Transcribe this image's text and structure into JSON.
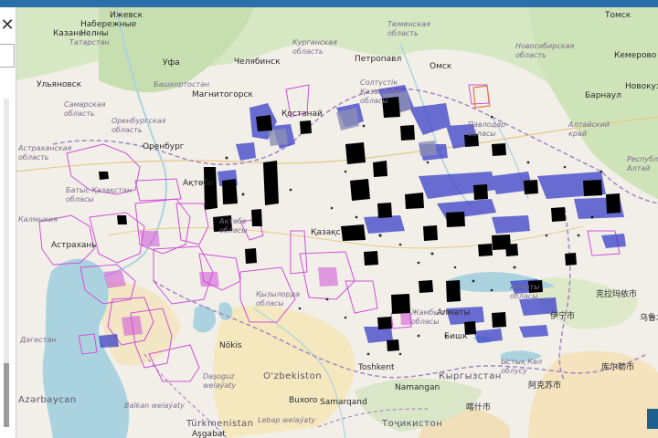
{
  "ui": {
    "close_icon": "✕",
    "accent_color": "#2a6fa8",
    "licence_outline": "#d050d8",
    "licence_fill": "#3a3fc8",
    "exploitation_fill": "#000000"
  },
  "labels": {
    "cities": [
      {
        "id": "izhevsk",
        "text": "Ижевск"
      },
      {
        "id": "chelny",
        "text": "Набережные\nЧелны"
      },
      {
        "id": "kazan",
        "text": "Казань"
      },
      {
        "id": "ufa",
        "text": "Уфа"
      },
      {
        "id": "chelyabinsk",
        "text": "Челябинск"
      },
      {
        "id": "magnitogorsk",
        "text": "Магнитогорск"
      },
      {
        "id": "ulyanovsk",
        "text": "Ульяновск"
      },
      {
        "id": "orenburg",
        "text": "Оренбург"
      },
      {
        "id": "petropavl",
        "text": "Петропавл"
      },
      {
        "id": "omsk",
        "text": "Омск"
      },
      {
        "id": "tomsk",
        "text": "Томск"
      },
      {
        "id": "kemerovo",
        "text": "Кемерово"
      },
      {
        "id": "novokuz",
        "text": "Новокуз"
      },
      {
        "id": "barnaul",
        "text": "Барнаул"
      },
      {
        "id": "kostanay",
        "text": "Қостанай"
      },
      {
        "id": "aktobe",
        "text": "Ақтөбе"
      },
      {
        "id": "astrakhan",
        "text": "Астрахань"
      },
      {
        "id": "kazakhstan",
        "text": "Қазақс"
      },
      {
        "id": "nukus",
        "text": "Nökis"
      },
      {
        "id": "bukhara",
        "text": "Buxoro"
      },
      {
        "id": "samarkand",
        "text": "Samarqand"
      },
      {
        "id": "tashkent",
        "text": "Toshkent"
      },
      {
        "id": "namangan",
        "text": "Namangan"
      },
      {
        "id": "almaty",
        "text": "Алматы"
      },
      {
        "id": "bishkek",
        "text": "Бишк"
      },
      {
        "id": "ashgabat",
        "text": "Aşgabat"
      },
      {
        "id": "karamay",
        "text": "克拉玛依市"
      },
      {
        "id": "urumqi",
        "text": "乌鲁木"
      },
      {
        "id": "yining",
        "text": "伊宁市"
      },
      {
        "id": "kuqa",
        "text": "库尔勒市"
      },
      {
        "id": "aksu",
        "text": "阿克苏市"
      },
      {
        "id": "kashgar",
        "text": "喀什市"
      }
    ],
    "regions": [
      {
        "id": "tatar",
        "text": "Татарстан"
      },
      {
        "id": "bashk",
        "text": "Башкортостан"
      },
      {
        "id": "kurgan",
        "text": "Курганская\nобласть"
      },
      {
        "id": "tyumen",
        "text": "Тюменская\nобласть"
      },
      {
        "id": "samara",
        "text": "Самарская\nобласть"
      },
      {
        "id": "orenburg_obl",
        "text": "Оренбургская\nобласть"
      },
      {
        "id": "novosib",
        "text": "Новосибирская\nобласть"
      },
      {
        "id": "altai",
        "text": "Алтайский\nкрай"
      },
      {
        "id": "altai_rep",
        "text": "Республика\nАлтай"
      },
      {
        "id": "astr_obl",
        "text": "Астраханская\nобласть"
      },
      {
        "id": "wkaz",
        "text": "Батыс Қазақстан\nобласы"
      },
      {
        "id": "pavlodar",
        "text": "Павлодар\nобласы"
      },
      {
        "id": "kyzylorda",
        "text": "Қызылорда\nобласы"
      },
      {
        "id": "soltustik",
        "text": "Солтүстік\nҚазақстан\nобласы"
      },
      {
        "id": "zhambyl",
        "text": "Жамбыл\nобласы"
      },
      {
        "id": "dashoguz",
        "text": "Daşoguz\nwelaýaty"
      },
      {
        "id": "balkan",
        "text": "Balkan welaýaty"
      },
      {
        "id": "lebap",
        "text": "Lebap welaýaty"
      },
      {
        "id": "dagestan",
        "text": "Дагестан"
      },
      {
        "id": "kalmyk",
        "text": "Калмыкия"
      },
      {
        "id": "aktobe_obl",
        "text": "Ақтөбе\nобласы"
      },
      {
        "id": "issyk",
        "text": "Ыстық Көл\nоблусу"
      },
      {
        "id": "almaty_obl",
        "text": "Алматы\nобласы"
      }
    ],
    "countries": [
      {
        "id": "uzb",
        "text": "O'zbekiston"
      },
      {
        "id": "turkm",
        "text": "Türkmenistan"
      },
      {
        "id": "kyrg",
        "text": "Кыргызстан"
      },
      {
        "id": "tajik",
        "text": "Тоҷикистон"
      },
      {
        "id": "azer",
        "text": "Azərbaycan"
      }
    ]
  }
}
